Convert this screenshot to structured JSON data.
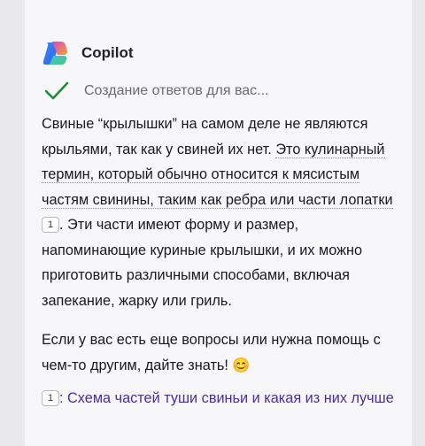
{
  "header": {
    "title": "Copilot",
    "logo_icon": "copilot-logo-icon"
  },
  "status": {
    "text": "Создание ответов для вас...",
    "icon": "check-icon",
    "icon_color": "#1f8a3a"
  },
  "answer": {
    "p1_a": "Свиные “крылышки” на самом деле не являются крыльями, так как у свиней их нет. ",
    "p1_b": "Это кулинарный термин, который обычно относится к мясистым частям свинины, таким как ребра или части лопатки",
    "p1_cite": "1",
    "p1_c": ". Эти части имеют форму и размер, напоминающие куриные крылышки, и их можно приготовить различными способами, включая запекание, жарку или гриль.",
    "p2": "Если у вас есть еще вопросы или нужна помощь с чем-то другим, дайте знать! 😊"
  },
  "references": [
    {
      "num": "1",
      "text": ": Схема частей туши свиньи и какая из них лучше"
    }
  ],
  "colors": {
    "link": "#4b2d9b",
    "background": "#e9e8ec",
    "card": "#f7f7f9"
  }
}
